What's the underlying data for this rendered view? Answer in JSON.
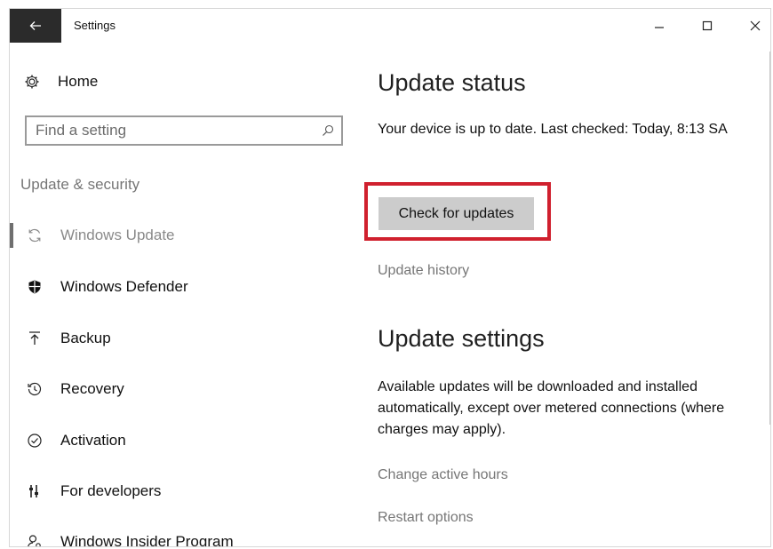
{
  "window": {
    "title": "Settings",
    "minimize_symbol": "–",
    "maximize_symbol": "☐",
    "close_symbol": "✕"
  },
  "sidebar": {
    "home_label": "Home",
    "search_placeholder": "Find a setting",
    "section_title": "Update & security",
    "items": [
      {
        "label": "Windows Update",
        "icon": "sync-icon",
        "selected": true
      },
      {
        "label": "Windows Defender",
        "icon": "shield-icon",
        "selected": false
      },
      {
        "label": "Backup",
        "icon": "upload-icon",
        "selected": false
      },
      {
        "label": "Recovery",
        "icon": "history-icon",
        "selected": false
      },
      {
        "label": "Activation",
        "icon": "check-circle-icon",
        "selected": false
      },
      {
        "label": "For developers",
        "icon": "developer-icon",
        "selected": false
      },
      {
        "label": "Windows Insider Program",
        "icon": "insider-icon",
        "selected": false
      }
    ]
  },
  "main": {
    "update_status_heading": "Update status",
    "status_text": "Your device is up to date. Last checked: Today, 8:13 SA",
    "check_button_label": "Check for updates",
    "update_history_link": "Update history",
    "update_settings_heading": "Update settings",
    "settings_text": "Available updates will be downloaded and installed automatically, except over metered connections (where charges may apply).",
    "change_active_hours_link": "Change active hours",
    "restart_options_link": "Restart options"
  },
  "colors": {
    "highlight_border": "#d0202e",
    "back_button_bg": "#2b2b2b",
    "button_bg": "#cccccc",
    "muted_text": "#767676"
  }
}
